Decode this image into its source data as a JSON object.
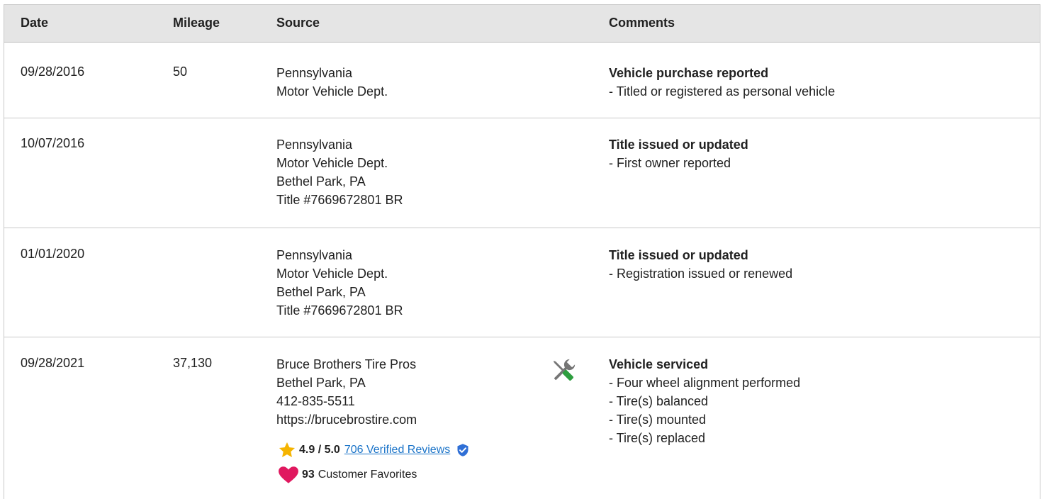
{
  "headers": {
    "date": "Date",
    "mileage": "Mileage",
    "source": "Source",
    "comments": "Comments"
  },
  "rows": [
    {
      "date": "09/28/2016",
      "mileage": "50",
      "source": [
        "Pennsylvania",
        "Motor Vehicle Dept."
      ],
      "comment_title": "Vehicle purchase reported",
      "comment_items": [
        "- Titled or registered as personal vehicle"
      ]
    },
    {
      "date": "10/07/2016",
      "mileage": "",
      "source": [
        "Pennsylvania",
        "Motor Vehicle Dept.",
        "Bethel Park, PA",
        "Title #7669672801 BR"
      ],
      "comment_title": "Title issued or updated",
      "comment_items": [
        "- First owner reported"
      ]
    },
    {
      "date": "01/01/2020",
      "mileage": "",
      "source": [
        "Pennsylvania",
        "Motor Vehicle Dept.",
        "Bethel Park, PA",
        "Title #7669672801 BR"
      ],
      "comment_title": "Title issued or updated",
      "comment_items": [
        "- Registration issued or renewed"
      ]
    },
    {
      "date": "09/28/2021",
      "mileage": "37,130",
      "source": [
        "Bruce Brothers Tire Pros",
        "Bethel Park, PA",
        "412-835-5511",
        "https://brucebrostire.com"
      ],
      "rating": "4.9 / 5.0",
      "reviews_link": "706 Verified Reviews",
      "favorites_count": "93",
      "favorites_label": "Customer Favorites",
      "comment_title": "Vehicle serviced",
      "comment_items": [
        "- Four wheel alignment performed",
        "- Tire(s) balanced",
        "- Tire(s) mounted",
        "- Tire(s) replaced"
      ]
    }
  ],
  "icons": {
    "service": "wrench-screwdriver-icon",
    "rating": "star-icon",
    "verified": "verified-shield-icon",
    "favorites": "heart-icon"
  },
  "colors": {
    "header_bg": "#e5e5e5",
    "star": "#f5b400",
    "link": "#1a73c8",
    "verified": "#2f6fd6",
    "heart": "#e0185f",
    "tool_gray": "#757575",
    "tool_green": "#2e9e3f"
  }
}
